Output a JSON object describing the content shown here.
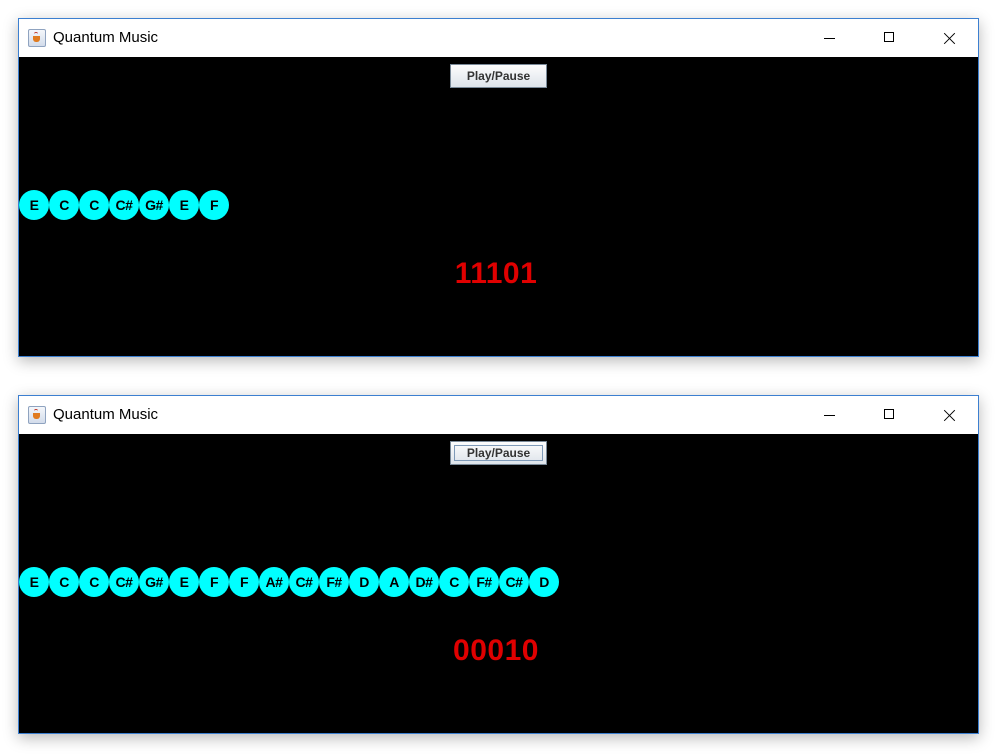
{
  "windows": [
    {
      "title": "Quantum Music",
      "play_pause_label": "Play/Pause",
      "play_pause_focused": false,
      "notes": [
        "E",
        "C",
        "C",
        "C#",
        "G#",
        "E",
        "F"
      ],
      "bits": "11101"
    },
    {
      "title": "Quantum Music",
      "play_pause_label": "Play/Pause",
      "play_pause_focused": true,
      "notes": [
        "E",
        "C",
        "C",
        "C#",
        "G#",
        "E",
        "F",
        "F",
        "A#",
        "C#",
        "F#",
        "D",
        "A",
        "D#",
        "C",
        "F#",
        "C#",
        "D"
      ],
      "bits": "00010"
    }
  ],
  "colors": {
    "background": "#000000",
    "note_fill": "#00ffff",
    "note_text": "#000000",
    "bits_text": "#e00000"
  },
  "icons": {
    "app": "java-coffee-cup-icon",
    "minimize": "minimize-icon",
    "maximize": "maximize-icon",
    "close": "close-icon"
  }
}
